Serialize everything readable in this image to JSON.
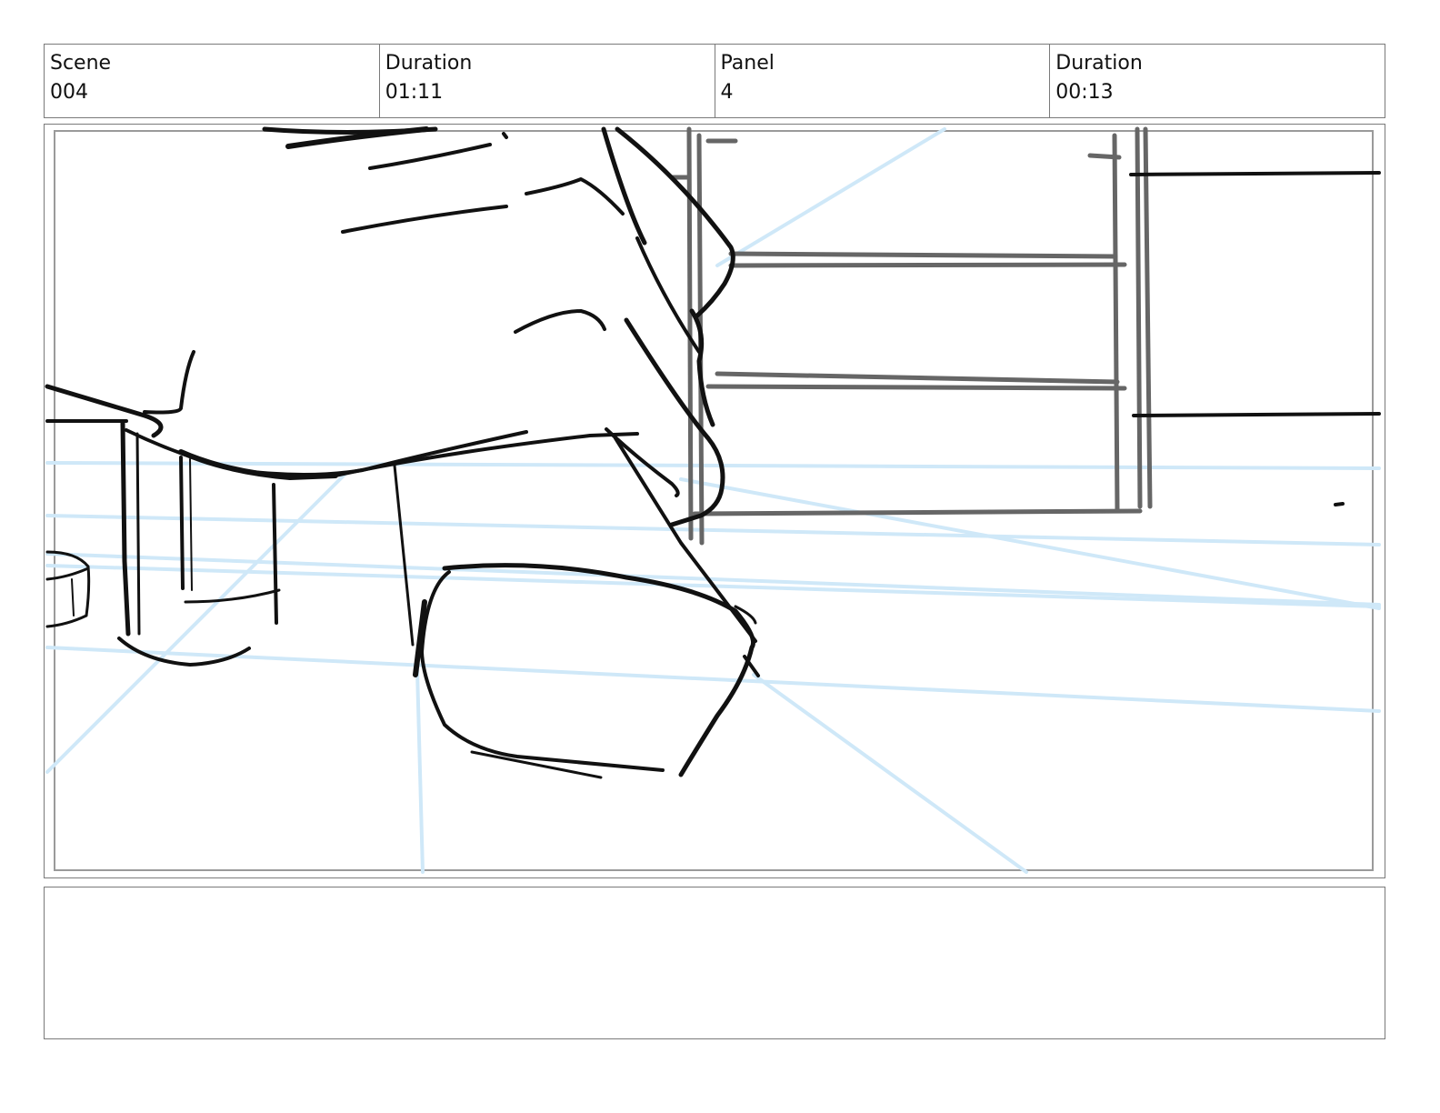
{
  "header": {
    "scene_label": "Scene",
    "scene_value": "004",
    "scene_duration_label": "Duration",
    "scene_duration_value": "01:11",
    "panel_label": "Panel",
    "panel_value": "4",
    "panel_duration_label": "Duration",
    "panel_duration_value": "00:13"
  },
  "notes": {
    "text": ""
  },
  "colors": {
    "border": "#7a7a7a",
    "ink": "#111111",
    "pencil_grey": "#666666",
    "perspective_blue": "#cfe8f8"
  }
}
